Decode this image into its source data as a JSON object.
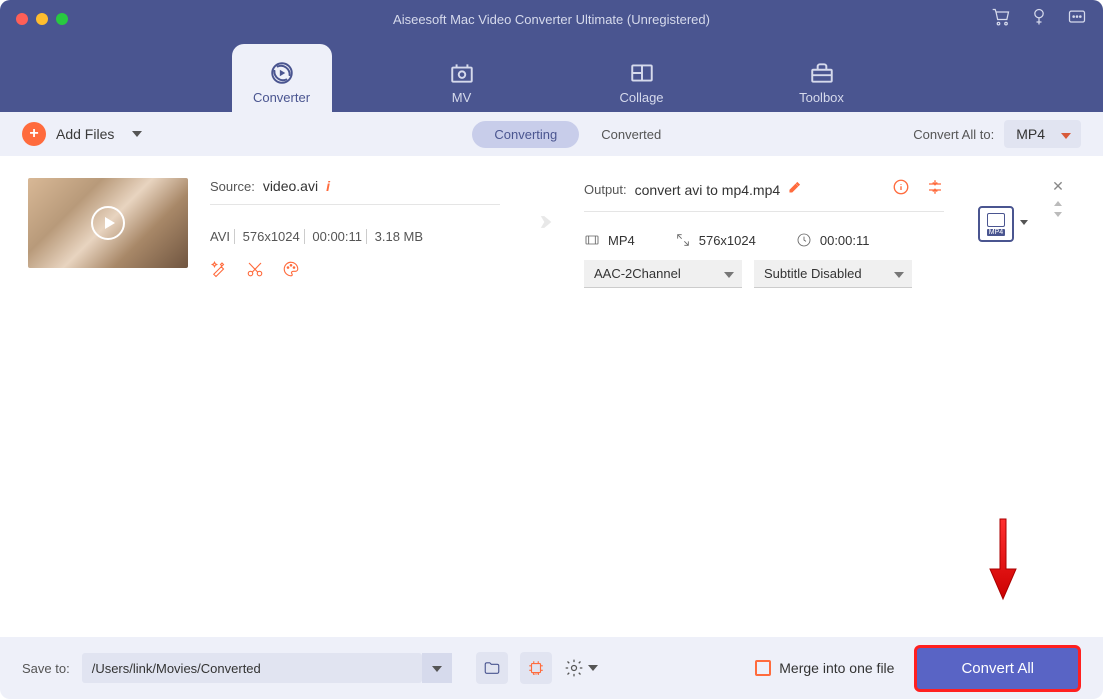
{
  "titlebar": {
    "title": "Aiseesoft Mac Video Converter Ultimate (Unregistered)"
  },
  "nav": {
    "converter": "Converter",
    "mv": "MV",
    "collage": "Collage",
    "toolbox": "Toolbox"
  },
  "toolbar": {
    "add_files": "Add Files",
    "converting": "Converting",
    "converted": "Converted",
    "convert_all_to": "Convert All to:",
    "target_format": "MP4"
  },
  "item": {
    "source_label": "Source:",
    "source_file": "video.avi",
    "src_format": "AVI",
    "src_res": "576x1024",
    "src_dur": "00:00:11",
    "src_size": "3.18 MB",
    "output_label": "Output:",
    "output_file": "convert avi to mp4.mp4",
    "out_format": "MP4",
    "out_res": "576x1024",
    "out_dur": "00:00:11",
    "audio_dd": "AAC-2Channel",
    "sub_dd": "Subtitle Disabled",
    "format_tag": "MP4"
  },
  "bottom": {
    "save_to": "Save to:",
    "path": "/Users/link/Movies/Converted",
    "merge": "Merge into one file",
    "convert": "Convert All"
  }
}
